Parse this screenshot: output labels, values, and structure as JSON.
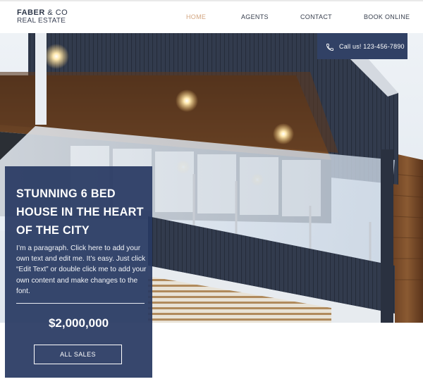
{
  "brand": {
    "name_bold": "FABER",
    "name_rest": " & CO",
    "subtitle": "REAL ESTATE"
  },
  "nav": {
    "items": [
      {
        "label": "HOME",
        "active": true
      },
      {
        "label": "AGENTS",
        "active": false
      },
      {
        "label": "CONTACT",
        "active": false
      },
      {
        "label": "BOOK ONLINE",
        "active": false
      }
    ]
  },
  "call": {
    "label": "Call us! 123-456-7890",
    "icon": "phone-icon"
  },
  "listing": {
    "title": "STUNNING 6 BED HOUSE IN THE HEART OF THE CITY",
    "description": "I’m a paragraph. Click here to add your own text and edit me. It’s easy. Just click “Edit Text” or double click me to add your own content and make changes to the font.",
    "price": "$2,000,000",
    "cta": "ALL SALES"
  },
  "colors": {
    "navy": "#314165",
    "card": "#283962",
    "accent": "#d3a681",
    "text_dark": "#2d3648"
  }
}
